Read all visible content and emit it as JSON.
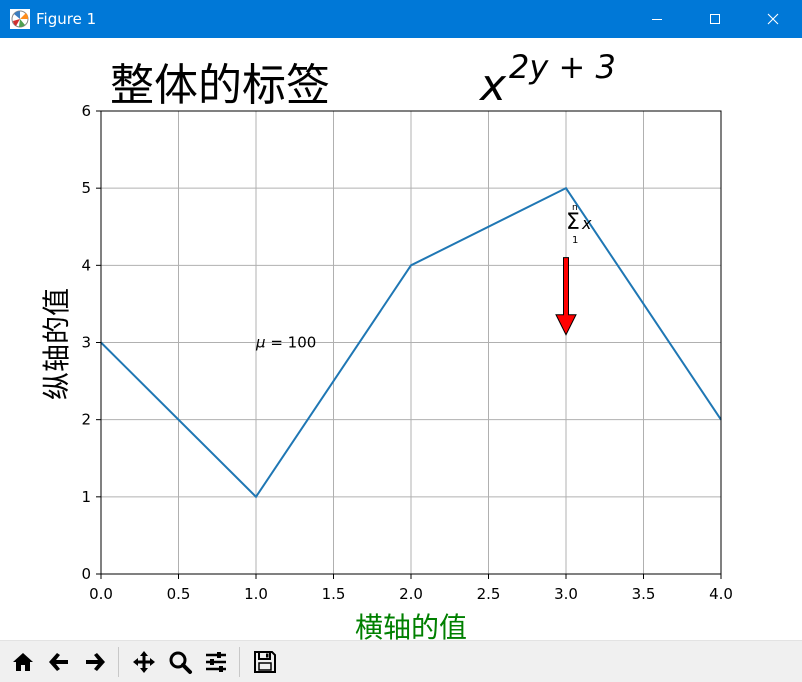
{
  "window": {
    "title": "Figure 1",
    "titlebar_color": "#0078d7"
  },
  "toolbar": {
    "buttons": [
      "home-icon",
      "back-arrow-icon",
      "forward-arrow-icon",
      "pan-icon",
      "zoom-icon",
      "subplots-config-icon",
      "save-icon"
    ]
  },
  "chart_data": {
    "type": "line",
    "title": "整体的标签",
    "title_math": {
      "base": "x",
      "exponent": "2y + 3"
    },
    "xlabel": "横轴的值",
    "ylabel": "纵轴的值",
    "xlabel_color": "#008000",
    "xlim": [
      0.0,
      4.0
    ],
    "ylim": [
      0,
      6
    ],
    "xticks": [
      "0.0",
      "0.5",
      "1.0",
      "1.5",
      "2.0",
      "2.5",
      "3.0",
      "3.5",
      "4.0"
    ],
    "yticks": [
      "0",
      "1",
      "2",
      "3",
      "4",
      "5",
      "6"
    ],
    "grid": true,
    "series": [
      {
        "x": [
          0,
          1,
          2,
          3,
          4
        ],
        "y": [
          3,
          1,
          4,
          5,
          2
        ],
        "color": "#1f77b4"
      }
    ],
    "annotations": {
      "mu_text": {
        "x": 1.0,
        "y": 3.0,
        "symbol": "μ",
        "equals": " = ",
        "value": "100"
      },
      "sum_text": {
        "x": 3.0,
        "y": 4.5,
        "symbol": "Σ",
        "upper": "n",
        "lower": "1",
        "var": "x"
      },
      "arrow": {
        "x": 3.0,
        "y_start": 4.1,
        "y_end": 3.1,
        "facecolor": "#ff0000",
        "edgecolor": "#000000"
      }
    }
  }
}
